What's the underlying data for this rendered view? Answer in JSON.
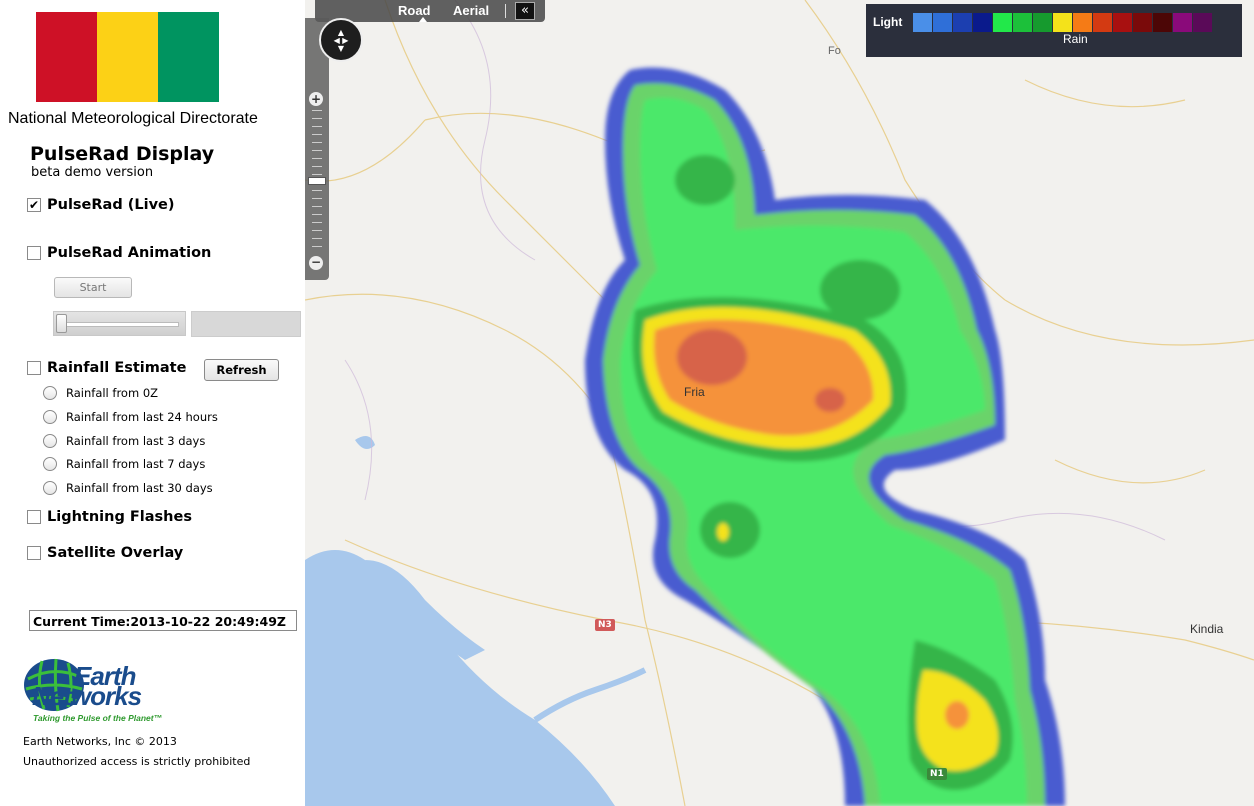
{
  "org_name": "National Meteorological Directorate",
  "flag_colors": [
    "#CE1126",
    "#FCD116",
    "#009460"
  ],
  "app_title": "PulseRad Display",
  "app_subtitle": "beta demo version",
  "options": {
    "live": {
      "label": "PulseRad (Live)",
      "checked": true
    },
    "animation": {
      "label": "PulseRad Animation",
      "checked": false
    },
    "rainfall": {
      "label": "Rainfall Estimate",
      "checked": false
    },
    "lightning": {
      "label": "Lightning Flashes",
      "checked": false
    },
    "satellite": {
      "label": "Satellite Overlay",
      "checked": false
    }
  },
  "animation": {
    "start_label": "Start",
    "slider_value": 0
  },
  "rainfall": {
    "refresh_label": "Refresh",
    "periods": [
      "Rainfall from 0Z",
      "Rainfall from last 24 hours",
      "Rainfall from last 3 days",
      "Rainfall from last 7 days",
      "Rainfall from last 30 days"
    ]
  },
  "current_time": "Current Time:2013-10-22 20:49:49Z",
  "logo": {
    "line1": "Earth",
    "line2": "Networks",
    "tagline": "Taking the Pulse of the Planet™"
  },
  "footer": {
    "copyright": "Earth Networks, Inc © 2013",
    "notice": "Unauthorized access is strictly prohibited"
  },
  "map": {
    "view_road": "Road",
    "view_aerial": "Aerial",
    "collapse_icon": "double-chevron-left-icon",
    "places": {
      "fria": "Fria",
      "kindia": "Kindia",
      "fo": "Fo"
    },
    "roads": {
      "n3": "N3",
      "n1": "N1"
    }
  },
  "legend": {
    "light_label": "Light",
    "rain_label": "Rain",
    "colors": [
      "#4a8fe8",
      "#2f6fd8",
      "#1c3fb0",
      "#0a1a8c",
      "#22e84a",
      "#1cc03a",
      "#169a2e",
      "#f4e21a",
      "#f57b16",
      "#d33a12",
      "#a81010",
      "#7a0a0a",
      "#4c0606",
      "#8a0a7a",
      "#5a0a58"
    ]
  }
}
